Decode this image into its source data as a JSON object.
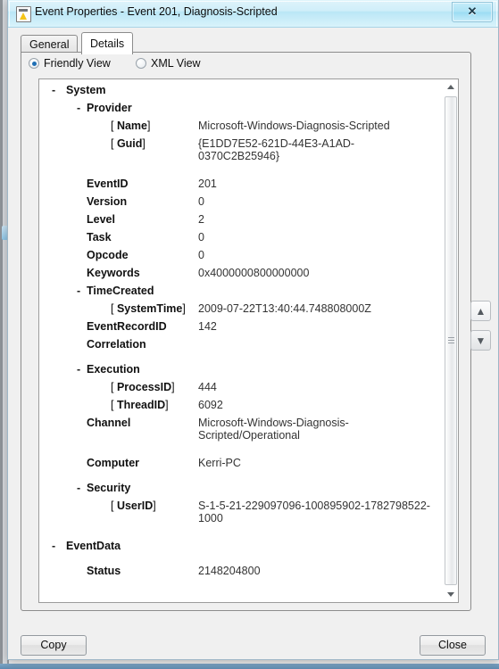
{
  "window": {
    "title": "Event Properties - Event 201, Diagnosis-Scripted",
    "icon": "event-properties-icon",
    "close_label": "✕"
  },
  "tabs": [
    {
      "label": "General",
      "active": false
    },
    {
      "label": "Details",
      "active": true
    }
  ],
  "view_modes": [
    {
      "label": "Friendly View",
      "checked": true
    },
    {
      "label": "XML View",
      "checked": false
    }
  ],
  "details": {
    "rows": [
      {
        "indent": 0,
        "collapse": "-",
        "label": "System",
        "value": "",
        "bracket": false,
        "bold_label": true
      },
      {
        "indent": 1,
        "collapse": "-",
        "label": "Provider",
        "value": "",
        "bracket": false,
        "bold_label": true
      },
      {
        "indent": 2,
        "collapse": "",
        "label": "Name",
        "value": "Microsoft-Windows-Diagnosis-Scripted",
        "bracket": true,
        "bold_label": true
      },
      {
        "indent": 2,
        "collapse": "",
        "label": "Guid",
        "value": "{E1DD7E52-621D-44E3-A1AD-0370C2B25946}",
        "bracket": true,
        "bold_label": true
      },
      {
        "indent": 1,
        "collapse": "",
        "label": "EventID",
        "value": "201",
        "bracket": false,
        "bold_label": true
      },
      {
        "indent": 1,
        "collapse": "",
        "label": "Version",
        "value": "0",
        "bracket": false,
        "bold_label": true
      },
      {
        "indent": 1,
        "collapse": "",
        "label": "Level",
        "value": "2",
        "bracket": false,
        "bold_label": true
      },
      {
        "indent": 1,
        "collapse": "",
        "label": "Task",
        "value": "0",
        "bracket": false,
        "bold_label": true
      },
      {
        "indent": 1,
        "collapse": "",
        "label": "Opcode",
        "value": "0",
        "bracket": false,
        "bold_label": true
      },
      {
        "indent": 1,
        "collapse": "",
        "label": "Keywords",
        "value": "0x4000000800000000",
        "bracket": false,
        "bold_label": true
      },
      {
        "indent": 1,
        "collapse": "-",
        "label": "TimeCreated",
        "value": "",
        "bracket": false,
        "bold_label": true
      },
      {
        "indent": 2,
        "collapse": "",
        "label": "SystemTime",
        "value": "2009-07-22T13:40:44.748808000Z",
        "bracket": true,
        "bold_label": true
      },
      {
        "indent": 1,
        "collapse": "",
        "label": "EventRecordID",
        "value": "142",
        "bracket": false,
        "bold_label": true
      },
      {
        "indent": 1,
        "collapse": "",
        "label": "Correlation",
        "value": "",
        "bracket": false,
        "bold_label": true
      },
      {
        "indent": 1,
        "collapse": "-",
        "label": "Execution",
        "value": "",
        "bracket": false,
        "bold_label": true
      },
      {
        "indent": 2,
        "collapse": "",
        "label": "ProcessID",
        "value": "444",
        "bracket": true,
        "bold_label": true
      },
      {
        "indent": 2,
        "collapse": "",
        "label": "ThreadID",
        "value": "6092",
        "bracket": true,
        "bold_label": true
      },
      {
        "indent": 1,
        "collapse": "",
        "label": "Channel",
        "value": "Microsoft-Windows-Diagnosis-Scripted/Operational",
        "bracket": false,
        "bold_label": true
      },
      {
        "indent": 1,
        "collapse": "",
        "label": "Computer",
        "value": "Kerri-PC",
        "bracket": false,
        "bold_label": true
      },
      {
        "indent": 1,
        "collapse": "-",
        "label": "Security",
        "value": "",
        "bracket": false,
        "bold_label": true
      },
      {
        "indent": 2,
        "collapse": "",
        "label": "UserID",
        "value": "S-1-5-21-229097096-100895902-1782798522-1000",
        "bracket": true,
        "bold_label": true
      },
      {
        "indent": 0,
        "collapse": "-",
        "label": "EventData",
        "value": "",
        "bracket": false,
        "bold_label": true
      },
      {
        "indent": 1,
        "collapse": "",
        "label": "Status",
        "value": "2148204800",
        "bracket": false,
        "bold_label": true
      }
    ]
  },
  "scrollbar": {
    "up_arrow": "scroll-up-arrow",
    "down_arrow": "scroll-down-arrow"
  },
  "side_buttons": {
    "up": "▲",
    "down": "▼"
  },
  "footer": {
    "copy_label": "Copy",
    "close_label": "Close"
  },
  "colors": {
    "titlebar": "#cfeef9",
    "accent": "#1f6fb5",
    "dialog_face": "#f0f0f0",
    "list_background": "#ffffff",
    "text": "#111111",
    "value_text": "#333333"
  }
}
